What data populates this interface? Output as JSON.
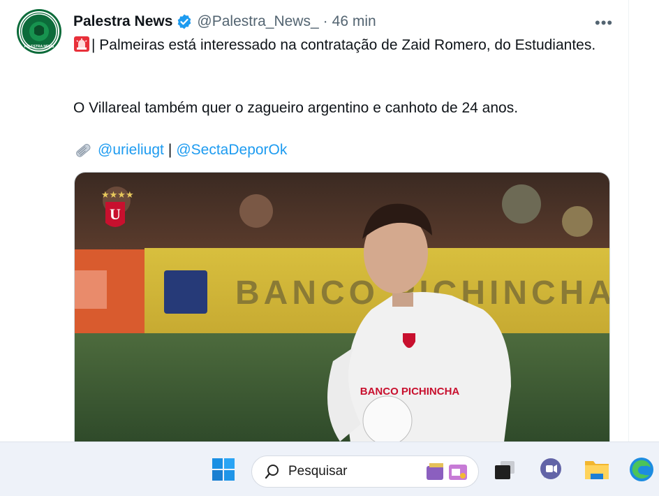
{
  "tweet": {
    "display_name": "Palestra News",
    "handle": "@Palestra_News_",
    "separator": "·",
    "time": "46 min",
    "more_label": "•••",
    "line1": "| Palmeiras está interessado na contratação de Zaid Romero, do Estudiantes.",
    "line2": "O Villareal também quer o zagueiro argentino e canhoto de 24 anos.",
    "mention1": "@urieliugt",
    "mention_sep": "|",
    "mention2": "@SectaDeporOk",
    "avatar_text": "PALESTRA NEWS",
    "media": {
      "description_badge_stars": "★★★★",
      "shirt_sponsor": "BANCO PICHINCHA",
      "board_text": "BANCO PICHINCHA",
      "crest_letter": "U"
    }
  },
  "taskbar": {
    "search_placeholder": "Pesquisar",
    "icons": [
      "windows-start-icon",
      "search-icon",
      "task-view-icon",
      "teams-chat-icon",
      "file-explorer-icon",
      "edge-browser-icon"
    ]
  },
  "colors": {
    "link": "#1d9bf0",
    "verified": "#1d9bf0",
    "muted": "#536471"
  }
}
